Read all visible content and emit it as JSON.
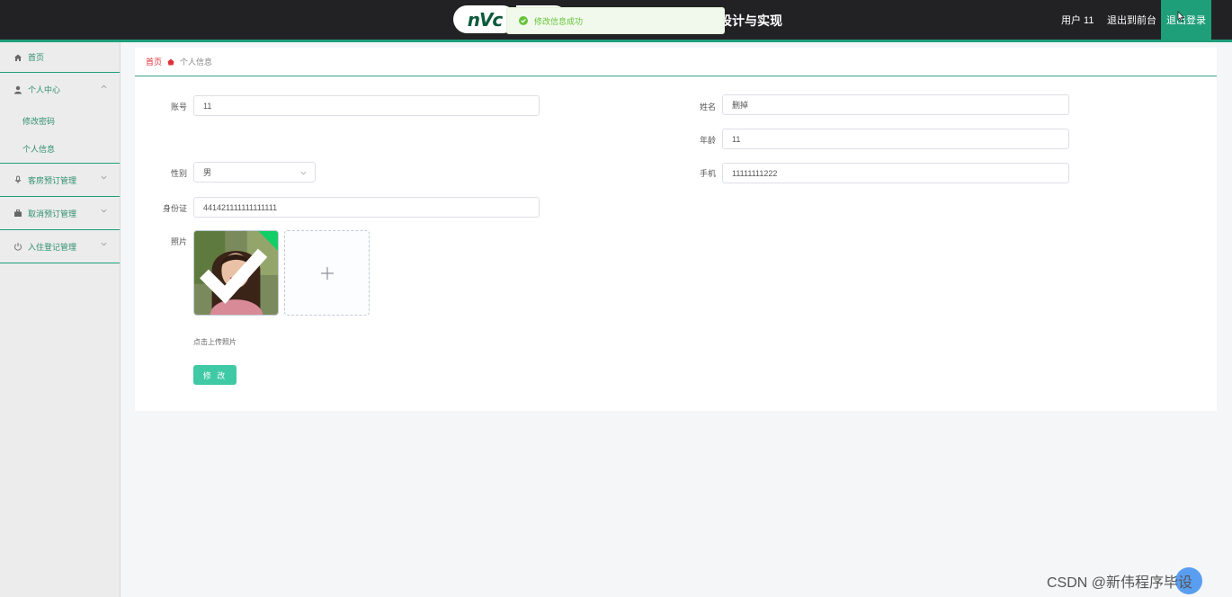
{
  "header": {
    "logo_text": "nVc",
    "title": "设计与实现",
    "user_label": "用户 11",
    "front_link": "退出到前台",
    "logout_button": "退出登录",
    "toast_message": "修改信息成功"
  },
  "sidebar": {
    "items": [
      {
        "label": "首页",
        "icon": "home-icon"
      },
      {
        "label": "个人中心",
        "icon": "user-icon",
        "children": [
          "修改密码",
          "个人信息"
        ]
      },
      {
        "label": "客房预订管理",
        "icon": "mic-icon"
      },
      {
        "label": "取消预订管理",
        "icon": "briefcase-icon"
      },
      {
        "label": "入住登记管理",
        "icon": "power-icon"
      }
    ]
  },
  "breadcrumb": {
    "home": "首页",
    "current": "个人信息"
  },
  "form": {
    "account_label": "账号",
    "account_value": "11",
    "name_label": "姓名",
    "name_value": "删掉",
    "age_label": "年龄",
    "age_value": "11",
    "gender_label": "性别",
    "gender_value": "男",
    "phone_label": "手机",
    "phone_value": "11111111222",
    "id_label": "身份证",
    "id_value": "441421111111111111",
    "photo_label": "照片",
    "upload_hint": "点击上传照片",
    "submit_label": "修 改"
  },
  "watermark": "CSDN @新伟程序毕设",
  "colors": {
    "accent": "#1f9e7a",
    "button": "#3fc9a5",
    "topbar": "#222224",
    "success": "#67c23a"
  }
}
